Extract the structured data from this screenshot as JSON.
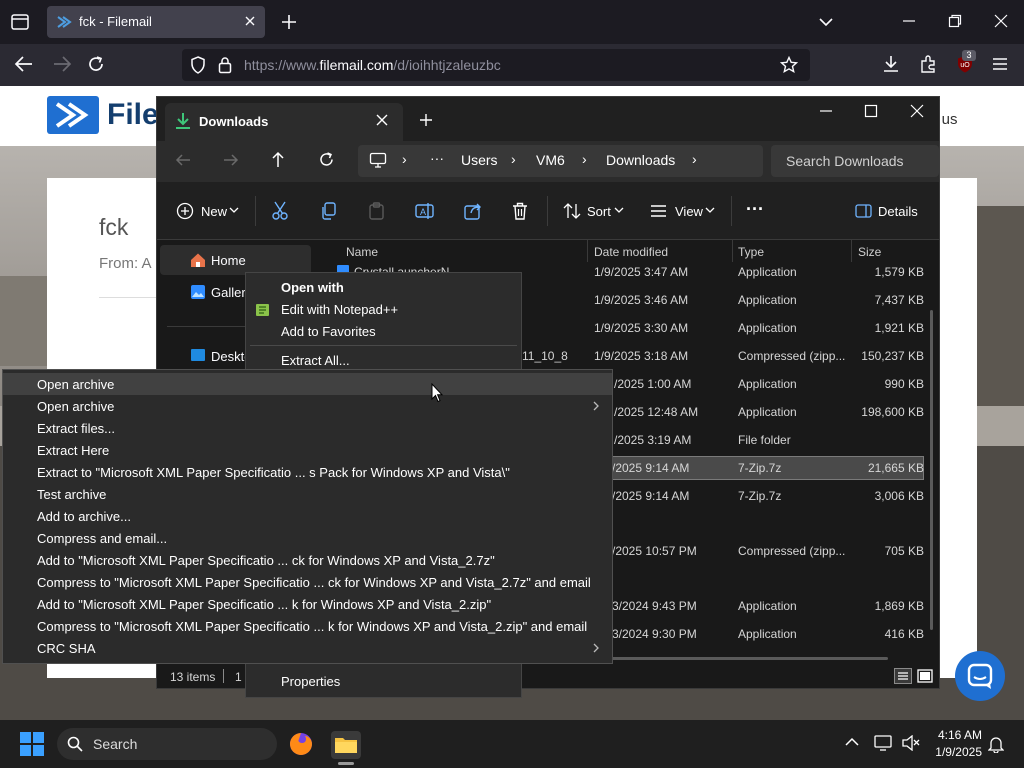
{
  "browser": {
    "tab_title": "fck - Filemail",
    "url_prefix": "https://www.",
    "url_domain": "filemail.com",
    "url_path": "/d/ioihhtjzaleuzbc",
    "extension_badge": "3"
  },
  "webpage": {
    "logo_text": "File",
    "nav_link": "ut us",
    "title": "fck",
    "from_label": "From: A"
  },
  "explorer": {
    "tab_title": "Downloads",
    "breadcrumb": [
      "Users",
      "VM6",
      "Downloads"
    ],
    "breadcrumb_overflow": "···",
    "search_placeholder": "Search Downloads",
    "cmd": {
      "new": "New",
      "sort": "Sort",
      "view": "View",
      "more": "···",
      "details": "Details"
    },
    "nav": {
      "home": "Home",
      "gallery": "Galler",
      "desktop": "Deskto"
    },
    "columns": {
      "name": "Name",
      "date": "Date modified",
      "type": "Type",
      "size": "Size"
    },
    "rows": [
      {
        "name": "Crystall auncherN",
        "date": "1/9/2025 3:47 AM",
        "type": "Application",
        "size": "1,579 KB"
      },
      {
        "name": "",
        "date": "1/9/2025 3:46 AM",
        "type": "Application",
        "size": "7,437 KB"
      },
      {
        "name": "",
        "date": "1/9/2025 3:30 AM",
        "type": "Application",
        "size": "1,921 KB"
      },
      {
        "name": "11_10_8",
        "date": "1/9/2025 3:18 AM",
        "type": "Compressed (zipp...",
        "size": "150,237 KB"
      },
      {
        "name": "",
        "date": "/2025 1:00 AM",
        "type": "Application",
        "size": "990 KB"
      },
      {
        "name": "",
        "date": "/2025 12:48 AM",
        "type": "Application",
        "size": "198,600 KB"
      },
      {
        "name": "",
        "date": "/2025 3:19 AM",
        "type": "File folder",
        "size": ""
      },
      {
        "name": "",
        "date": "/2025 9:14 AM",
        "type": "7-Zip.7z",
        "size": "21,665 KB"
      },
      {
        "name": "",
        "date": "/2025 9:14 AM",
        "type": "7-Zip.7z",
        "size": "3,006 KB"
      },
      {
        "name": "",
        "date": "/2025 10:57 PM",
        "type": "Compressed (zipp...",
        "size": "705 KB"
      },
      {
        "name": "",
        "date": "3/2024 9:43 PM",
        "type": "Application",
        "size": "1,869 KB"
      },
      {
        "name": "",
        "date": "3/2024 9:30 PM",
        "type": "Application",
        "size": "416 KB"
      }
    ],
    "status_items": "13 items",
    "status_sel": "1"
  },
  "context_menu": {
    "open_with": "Open with",
    "edit_notepad": "Edit with Notepad++",
    "add_favorites": "Add to Favorites",
    "extract_all": "Extract All...",
    "properties": "Properties"
  },
  "sevenzip_menu": {
    "items": [
      "Open archive",
      "Open archive",
      "Extract files...",
      "Extract Here",
      "Extract to \"Microsoft XML Paper Specificatio ... s Pack for Windows XP and Vista\\\"",
      "Test archive",
      "Add to archive...",
      "Compress and email...",
      "Add to \"Microsoft XML Paper Specificatio ... ck for Windows XP and Vista_2.7z\"",
      "Compress to \"Microsoft XML Paper Specificatio ... ck for Windows XP and Vista_2.7z\" and email",
      "Add to \"Microsoft XML Paper Specificatio ... k for Windows XP and Vista_2.zip\"",
      "Compress to \"Microsoft XML Paper Specificatio ... k for Windows XP and Vista_2.zip\" and email",
      "CRC SHA"
    ]
  },
  "taskbar": {
    "search": "Search",
    "time": "4:16 AM",
    "date": "1/9/2025"
  }
}
